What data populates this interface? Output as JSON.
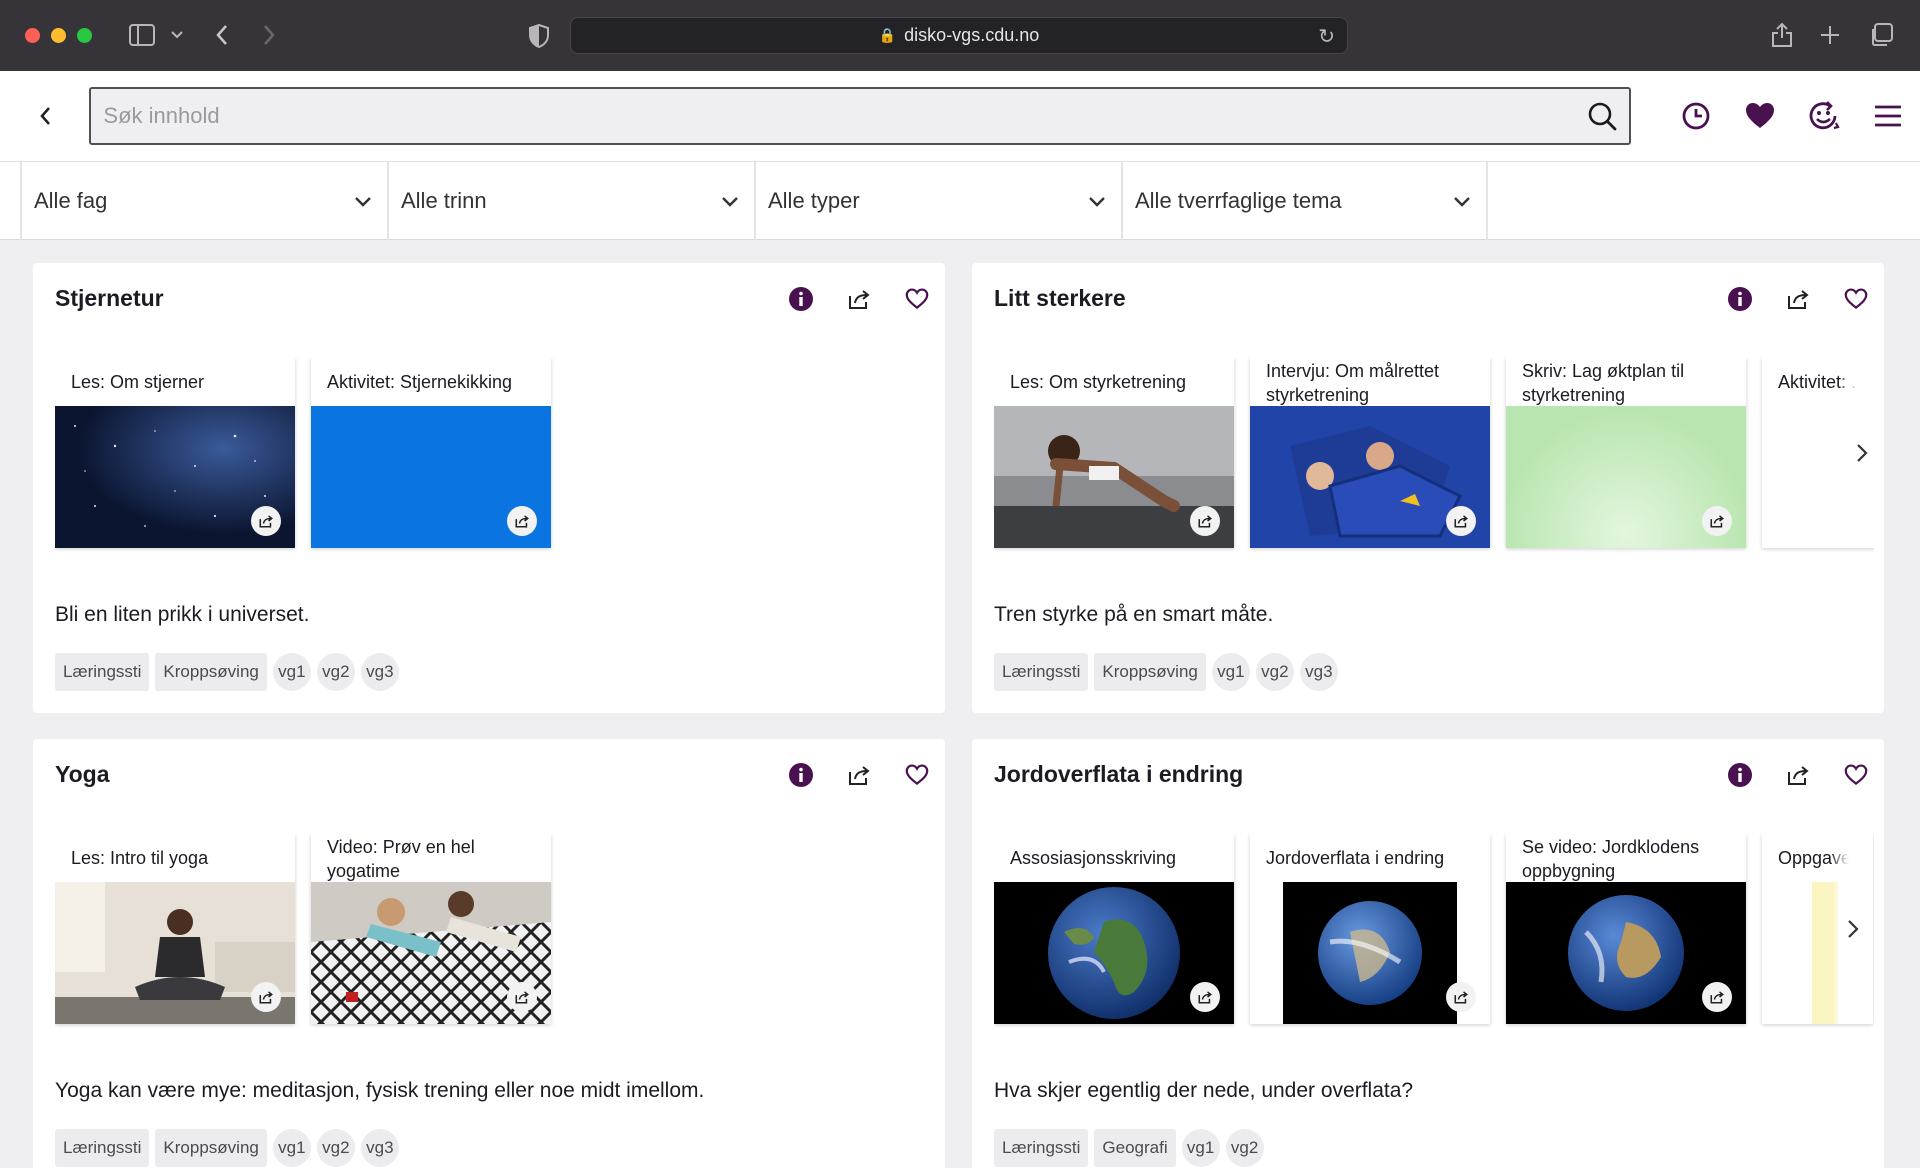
{
  "browser": {
    "url": "disko-vgs.cdu.no"
  },
  "search": {
    "placeholder": "Søk innhold"
  },
  "filters": [
    {
      "label": "Alle fag"
    },
    {
      "label": "Alle trinn"
    },
    {
      "label": "Alle typer"
    },
    {
      "label": "Alle tverrfaglige tema"
    }
  ],
  "cards": [
    {
      "title": "Stjernetur",
      "description": "Bli en liten prikk i universet.",
      "tiles": [
        {
          "label": "Les: Om stjerner"
        },
        {
          "label": "Aktivitet: Stjernekikking"
        }
      ],
      "tags": [
        "Læringssti",
        "Kroppsøving",
        "vg1",
        "vg2",
        "vg3"
      ]
    },
    {
      "title": "Litt sterkere",
      "description": "Tren styrke på en smart måte.",
      "tiles": [
        {
          "label": "Les: Om styrketrening"
        },
        {
          "label": "Intervju: Om målrettet styrketrening"
        },
        {
          "label": "Skriv: Lag øktplan til styrketrening"
        },
        {
          "label": "Aktivitet: ..."
        }
      ],
      "tags": [
        "Læringssti",
        "Kroppsøving",
        "vg1",
        "vg2",
        "vg3"
      ]
    },
    {
      "title": "Yoga",
      "description": "Yoga kan være mye: meditasjon, fysisk trening eller noe midt imellom.",
      "tiles": [
        {
          "label": "Les: Intro til yoga"
        },
        {
          "label": "Video: Prøv en hel yogatime"
        }
      ],
      "tags": [
        "Læringssti",
        "Kroppsøving",
        "vg1",
        "vg2",
        "vg3"
      ]
    },
    {
      "title": "Jordoverflata i endring",
      "description": "Hva skjer egentlig der nede, under overflata?",
      "tiles": [
        {
          "label": "Assosiasjonsskriving"
        },
        {
          "label": "Jordoverflata i endring"
        },
        {
          "label": "Se video: Jordklodens oppbygning"
        },
        {
          "label": "Oppgaver"
        }
      ],
      "tags": [
        "Læringssti",
        "Geografi",
        "vg1",
        "vg2"
      ]
    }
  ],
  "colors": {
    "accent": "#4a1150",
    "tile_blue": "#0a74e0",
    "tile_green": "#b9e6b0"
  }
}
